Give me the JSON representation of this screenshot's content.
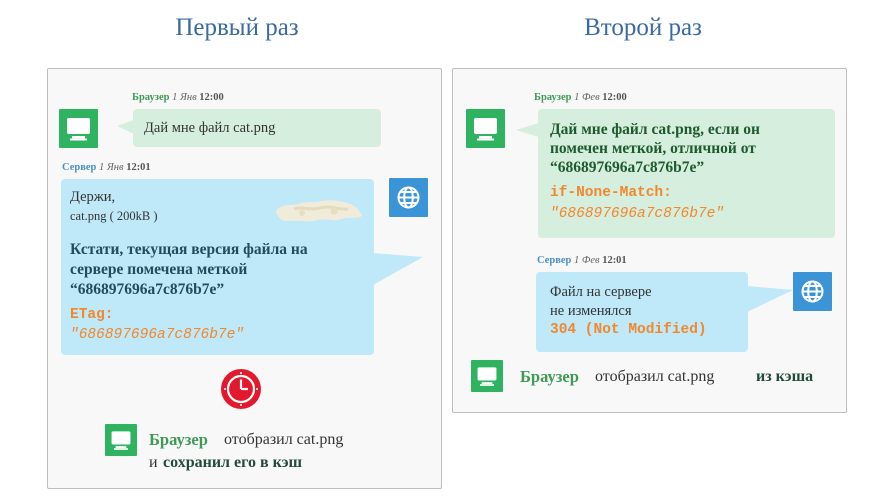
{
  "left": {
    "title": "Первый раз",
    "browser_meta": {
      "who": "Браузер",
      "date": "1 Янв",
      "time": "12:00"
    },
    "request": "Дай мне файл cat.png",
    "server_meta": {
      "who": "Сервер",
      "date": "1 Янв",
      "time": "12:01"
    },
    "response_line1": "Держи,",
    "response_file": "cat.png (  200kB )",
    "response_bold": [
      "Кстати, текущая версия файла на",
      "сервере помечена меткой",
      "“686897696a7c876b7e”"
    ],
    "etag_label": "ETag:",
    "etag_value": "\"686897696a7c876b7e\"",
    "result_who": "Браузер",
    "result_text": "отобразил cat.png",
    "result_and": "и",
    "result_cache": "сохранил его в кэш"
  },
  "right": {
    "title": "Второй раз",
    "browser_meta": {
      "who": "Браузер",
      "date": "1 Фев",
      "time": "12:00"
    },
    "request_bold": [
      "Дай мне файл cat.png, если он",
      "помечен меткой, отличной от",
      "“686897696a7c876b7e”"
    ],
    "header_label": "if-None-Match:",
    "header_value": "\"686897696a7c876b7e\"",
    "server_meta": {
      "who": "Сервер",
      "date": "1 Фев",
      "time": "12:01"
    },
    "response_line1": "Файл на сервере",
    "response_line2": "не изменялся",
    "status": "304 (Not Modified)",
    "result_who": "Браузер",
    "result_text": "отобразил cat.png",
    "result_cache": "из кэша"
  },
  "icons": {
    "browser": "monitor-icon",
    "server": "globe-icon",
    "clock": "clock-icon",
    "image": "cat-image"
  },
  "colors": {
    "title": "#3a6aa0",
    "browser_icon": "#2fb360",
    "server_icon": "#3a94d6",
    "green_bubble": "#d6eedd",
    "blue_bubble": "#bfe9f8",
    "orange_code": "#f0882e",
    "clock": "#e3182d"
  }
}
